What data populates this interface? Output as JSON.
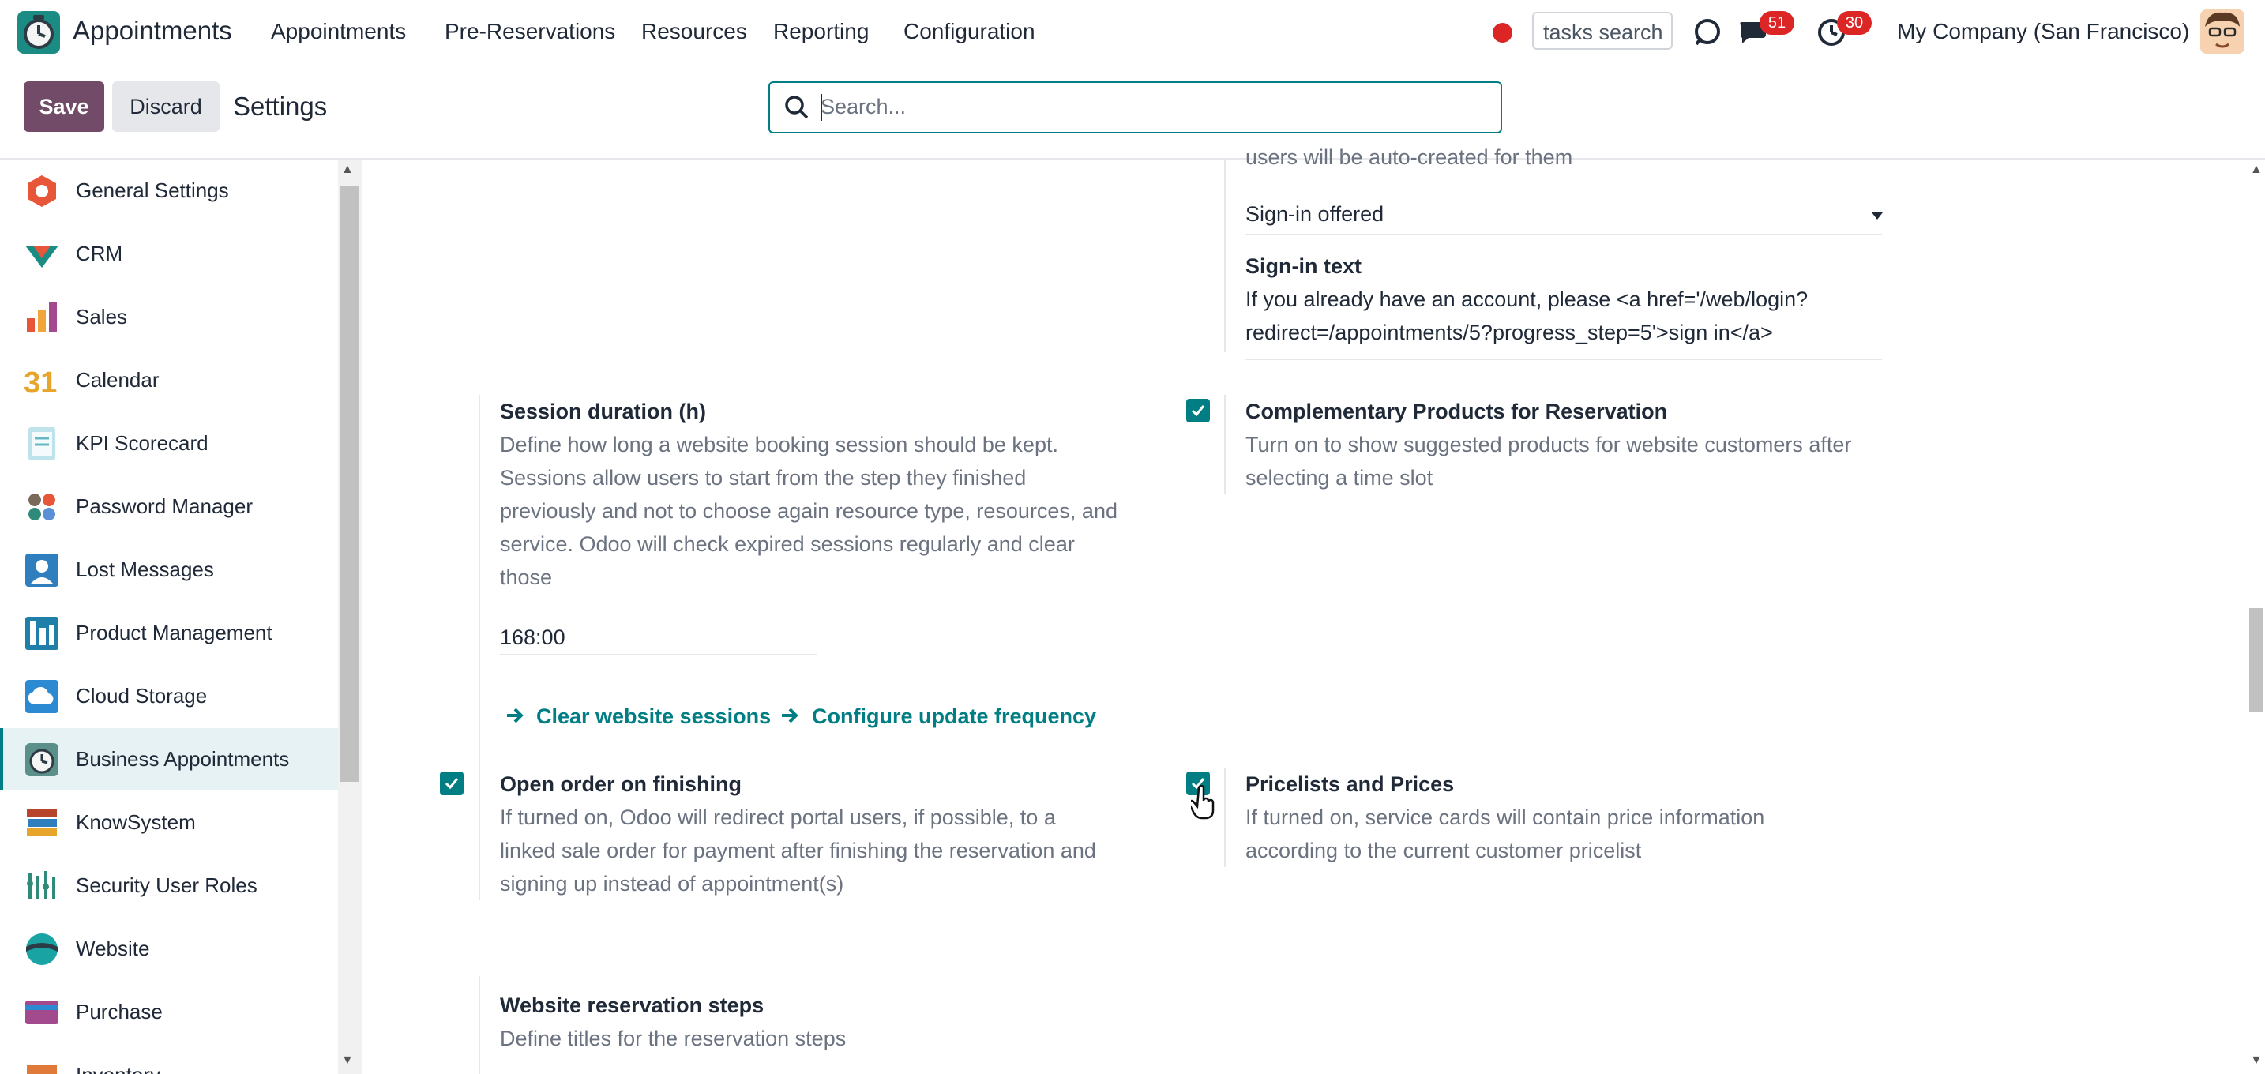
{
  "header": {
    "app_title": "Appointments",
    "menu": [
      "Appointments",
      "Pre-Reservations",
      "Resources",
      "Reporting",
      "Configuration"
    ],
    "tasks_search": "tasks search",
    "messages_count": "51",
    "activities_count": "30",
    "company": "My Company (San Francisco)"
  },
  "controls": {
    "save_label": "Save",
    "discard_label": "Discard",
    "breadcrumb": "Settings",
    "search_placeholder": "Search..."
  },
  "sidebar": {
    "items": [
      {
        "label": "General Settings",
        "icon": "general-settings-icon",
        "color": "#e8563a"
      },
      {
        "label": "CRM",
        "icon": "crm-icon",
        "color": "#1b8c84"
      },
      {
        "label": "Sales",
        "icon": "sales-icon",
        "color": "#f2a53a"
      },
      {
        "label": "Calendar",
        "icon": "calendar-icon",
        "color": "#e8a52c"
      },
      {
        "label": "KPI Scorecard",
        "icon": "kpi-scorecard-icon",
        "color": "#65b8c5"
      },
      {
        "label": "Password Manager",
        "icon": "password-manager-icon",
        "color": "#7b6a5a"
      },
      {
        "label": "Lost Messages",
        "icon": "lost-messages-icon",
        "color": "#2f7fbf"
      },
      {
        "label": "Product Management",
        "icon": "product-management-icon",
        "color": "#1f7fa8"
      },
      {
        "label": "Cloud Storage",
        "icon": "cloud-storage-icon",
        "color": "#2b8ad1"
      },
      {
        "label": "Business Appointments",
        "icon": "business-appointments-icon",
        "color": "#5a8f8a",
        "active": true
      },
      {
        "label": "KnowSystem",
        "icon": "knowsystem-icon",
        "color": "#b6452c"
      },
      {
        "label": "Security User Roles",
        "icon": "security-user-roles-icon",
        "color": "#2f8a7a"
      },
      {
        "label": "Website",
        "icon": "website-icon",
        "color": "#1aa3a3"
      },
      {
        "label": "Purchase",
        "icon": "purchase-icon",
        "color": "#a34a8f"
      },
      {
        "label": "Inventory",
        "icon": "inventory-icon",
        "color": "#e07a3a"
      }
    ]
  },
  "settings": {
    "top_partial_text": "users will be auto-created for them",
    "signin_select_value": "Sign-in offered",
    "signin_text_title": "Sign-in text",
    "signin_text_line1": "If you already have an account, please <a href='/web/login?",
    "signin_text_line2": "redirect=/appointments/5?progress_step=5'>sign in</a>",
    "session_title": "Session duration (h)",
    "session_desc": [
      "Define how long a website booking session should be kept.",
      "Sessions allow users to start from the step they finished",
      "previously and not to choose again resource type, resources, and",
      "service. Odoo will check expired sessions regularly and clear",
      "those"
    ],
    "session_value": "168:00",
    "clear_sessions_link": "Clear website sessions",
    "configure_frequency_link": "Configure update frequency",
    "complementary_title": "Complementary Products for Reservation",
    "complementary_desc": [
      "Turn on to show suggested products for website customers after",
      "selecting a time slot"
    ],
    "open_order_title": "Open order on finishing",
    "open_order_desc": [
      "If turned on, Odoo will redirect portal users, if possible, to a",
      "linked sale order for payment after finishing the reservation and",
      "signing up instead of appointment(s)"
    ],
    "pricelists_title": "Pricelists and Prices",
    "pricelists_desc": [
      "If turned on, service cards will contain price information",
      "according to the current customer pricelist"
    ],
    "steps_title": "Website reservation steps",
    "steps_desc": "Define titles for the reservation steps"
  }
}
